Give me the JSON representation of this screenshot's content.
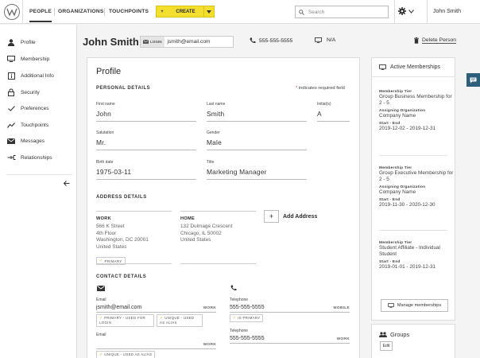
{
  "topbar": {
    "nav": [
      "PEOPLE",
      "ORGANIZATIONS",
      "TOUCHPOINTS"
    ],
    "create_label": "CREATE",
    "search_placeholder": "Search",
    "user_name": "John Smith"
  },
  "sidebar": {
    "items": [
      {
        "label": "Profile",
        "icon": "person-icon"
      },
      {
        "label": "Membership",
        "icon": "monitor-icon"
      },
      {
        "label": "Additional Info",
        "icon": "info-icon"
      },
      {
        "label": "Security",
        "icon": "lock-icon"
      },
      {
        "label": "Preferences",
        "icon": "check-icon"
      },
      {
        "label": "Touchpoints",
        "icon": "trend-icon"
      },
      {
        "label": "Messages",
        "icon": "envelope-icon"
      },
      {
        "label": "Relationships",
        "icon": "relationship-icon"
      }
    ]
  },
  "header": {
    "name": "John Smith",
    "login_tag": "LOGIN",
    "email": "jsmith@email.com",
    "phone": "555-555-5555",
    "na": "N/A",
    "delete_label": "Delete Person"
  },
  "profile": {
    "title": "Profile",
    "personal_heading": "PERSONAL DETAILS",
    "required_note": "indicates required field",
    "fields": {
      "first_name": {
        "label": "First name",
        "value": "John"
      },
      "last_name": {
        "label": "Last name",
        "value": "Smith"
      },
      "initials": {
        "label": "Initial(s)",
        "value": "A"
      },
      "salutation": {
        "label": "Salutation",
        "value": "Mr."
      },
      "gender": {
        "label": "Gender",
        "value": "Male"
      },
      "birth_date": {
        "label": "Birth date",
        "value": "1975-03-11"
      },
      "title": {
        "label": "Title",
        "value": "Marketing Manager"
      }
    },
    "address_heading": "ADDRESS DETAILS",
    "addresses": [
      {
        "type": "WORK",
        "lines": [
          "566 K Street",
          "4th Floor",
          "Washington, DC 20001",
          "United States"
        ],
        "badge": "PRIMARY"
      },
      {
        "type": "HOME",
        "lines": [
          "132 Dulmage Crescent",
          "Chicago, IL 50002",
          "United States"
        ]
      }
    ],
    "add_address_label": "Add Address",
    "contact_heading": "CONTACT DETAILS",
    "emails": [
      {
        "label": "Email",
        "value": "jsmith@email.com",
        "kind": "WORK",
        "chips": [
          "PRIMARY - USED FOR LOGIN",
          "UNIQUE - USED AS ALIAS"
        ]
      },
      {
        "label": "Email",
        "value": "",
        "kind": "WORK",
        "chips": [
          "UNIQUE - USED AS ALIAS"
        ]
      }
    ],
    "phones": [
      {
        "label": "Telephone",
        "value": "555-555-5555",
        "kind": "MOBILE",
        "chips": [
          "IS PRIMARY"
        ]
      },
      {
        "label": "Telephone",
        "value": "555-555-5555",
        "kind": "WORK"
      }
    ]
  },
  "memberships": {
    "heading": "Active Memberships",
    "tier_label": "Membership Tier",
    "org_label": "Assigning Organization",
    "date_label": "Start - End",
    "items": [
      {
        "tier": "Group Business Membership for 2 - 5",
        "org": "Company Name",
        "dates": "2019-12-02 - 2019-12-31"
      },
      {
        "tier": "Group Executive Membership for 2 - 5",
        "org": "Company Name",
        "dates": "2019-11-30 - 2020-12-30"
      },
      {
        "tier": "Student Affiliate - Individual Student",
        "dates": "2019-01-01 - 2019-12-31"
      }
    ],
    "manage_label": "Manage memberships"
  },
  "groups": {
    "heading": "Groups",
    "edit_label": "Edit"
  },
  "colors": {
    "accent_yellow": "#f5df2e",
    "chat_blue": "#2e5f7a"
  }
}
